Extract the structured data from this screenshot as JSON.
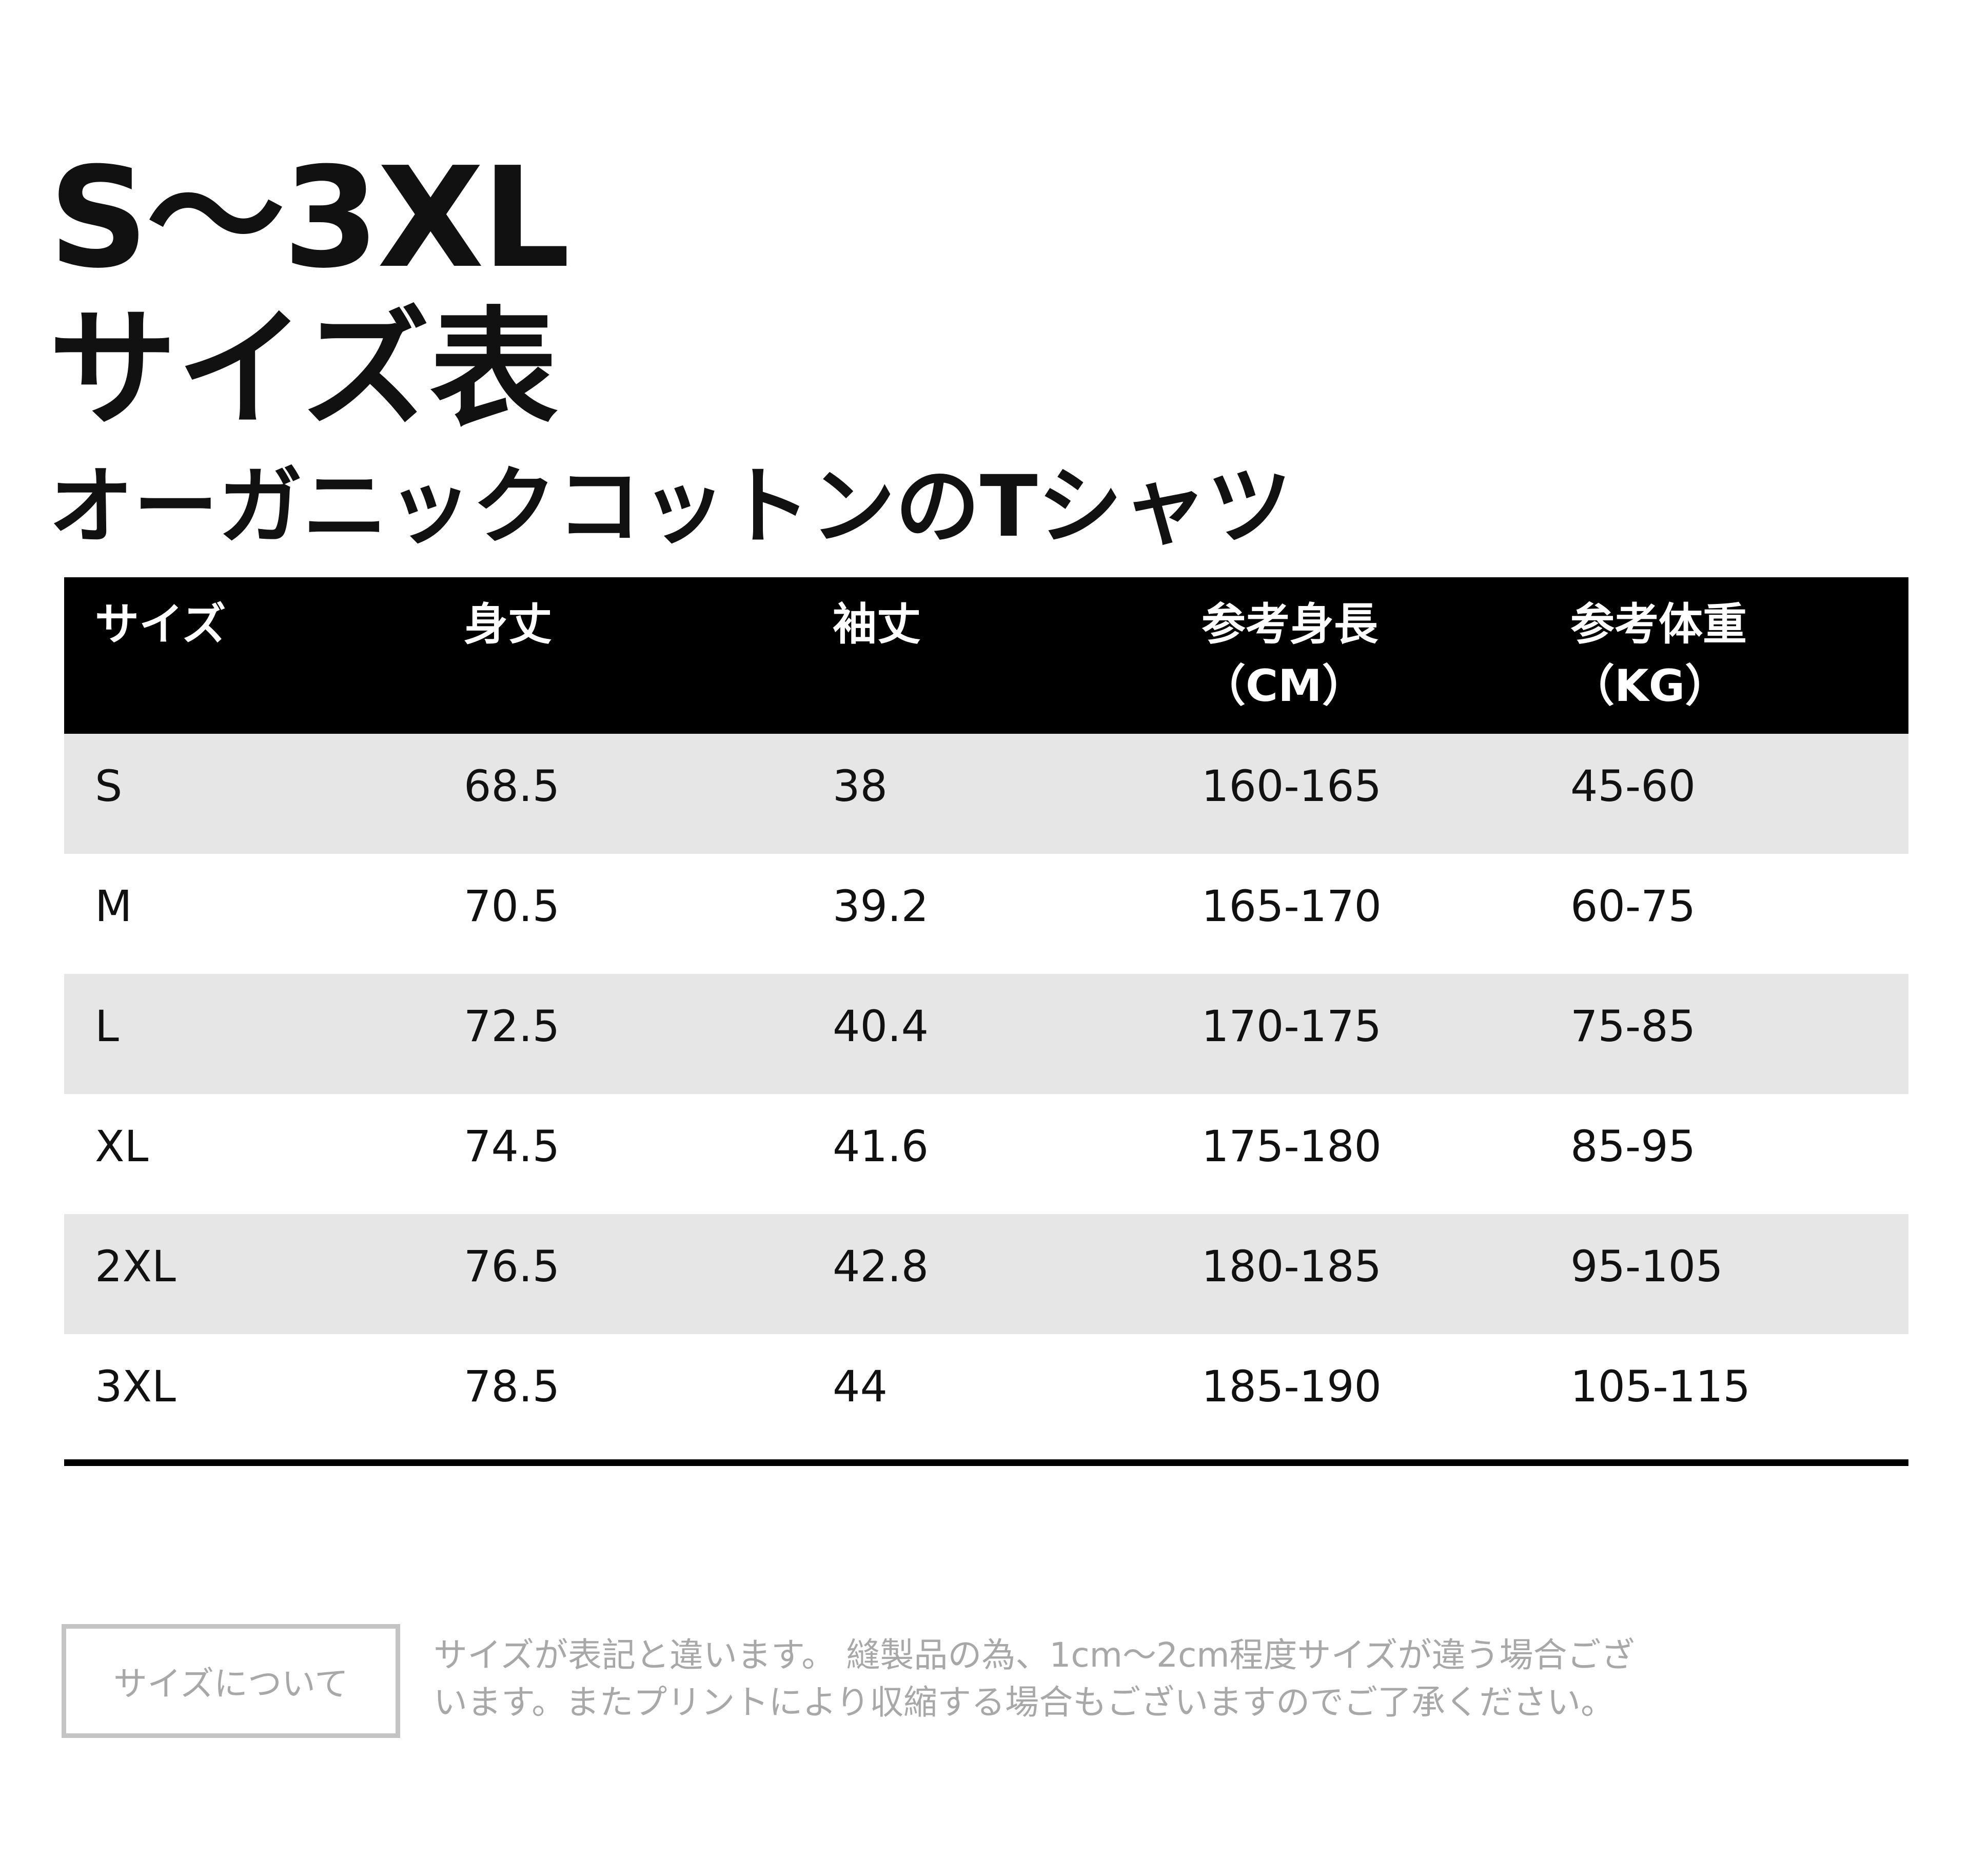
{
  "title": {
    "line1": "S～3XL",
    "line2": "サイズ表",
    "subtitle": "オーガニックコットンのTシャツ"
  },
  "table": {
    "headers": [
      {
        "line1": "サイズ",
        "line2": ""
      },
      {
        "line1": "身丈",
        "line2": ""
      },
      {
        "line1": "袖丈",
        "line2": ""
      },
      {
        "line1": "参考身長",
        "line2": "（CM）"
      },
      {
        "line1": "参考体重",
        "line2": "（KG）"
      }
    ],
    "rows": [
      [
        "S",
        "68.5",
        "38",
        "160-165",
        "45-60"
      ],
      [
        "M",
        "70.5",
        "39.2",
        "165-170",
        "60-75"
      ],
      [
        "L",
        "72.5",
        "40.4",
        "170-175",
        "75-85"
      ],
      [
        "XL",
        "74.5",
        "41.6",
        "175-180",
        "85-95"
      ],
      [
        "2XL",
        "76.5",
        "42.8",
        "180-185",
        "95-105"
      ],
      [
        "3XL",
        "78.5",
        "44",
        "185-190",
        "105-115"
      ]
    ]
  },
  "footer": {
    "about_label": "サイズについて",
    "note_line1": "サイズが表記と違います。 縫製品の為、1cm～2cm程度サイズが違う場合ござ",
    "note_line2": "います。またプリントにより収縮する場合もございますのでご了承ください。"
  },
  "colors": {
    "header_bg": "#000000",
    "header_text": "#ffffff",
    "row_shade": "#e6e6e6",
    "note_text": "#a8a8a8"
  }
}
